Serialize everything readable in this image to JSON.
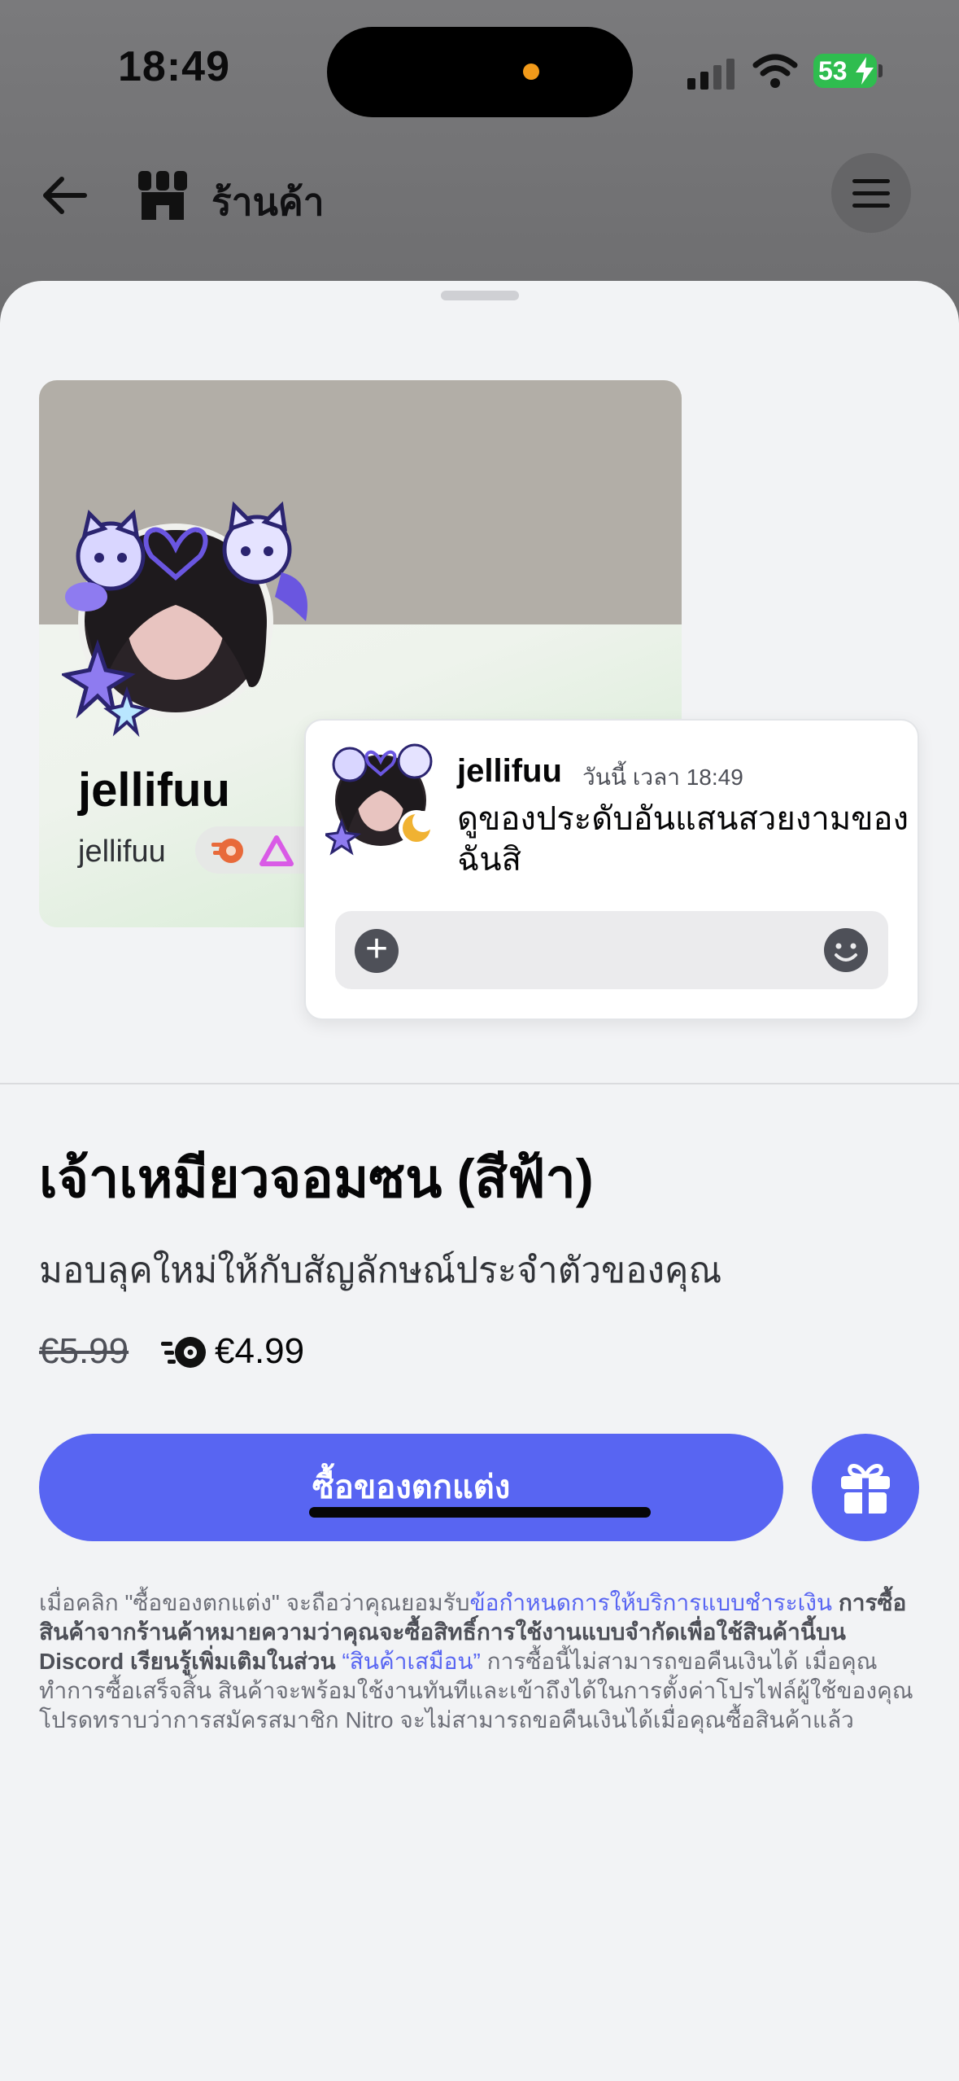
{
  "status_bar": {
    "time": "18:49",
    "battery_percent": "53",
    "signal_icon": "cellular-signal-icon",
    "wifi_icon": "wifi-icon",
    "battery_icon": "battery-charging-icon"
  },
  "header": {
    "title": "ร้านค้า",
    "back_icon": "arrow-left-icon",
    "shop_icon": "shop-icon",
    "menu_icon": "hamburger-menu-icon"
  },
  "preview": {
    "profile": {
      "display_name": "jellifuu",
      "username": "jellifuu",
      "badges": [
        "nitro-boost-badge-icon",
        "purple-triangle-badge-icon"
      ]
    },
    "message": {
      "author": "jellifuu",
      "timestamp": "วันนี้ เวลา 18:49",
      "text": "ดูของประดับอันแสนสวยงามของฉันสิ"
    }
  },
  "product": {
    "title": "เจ้าเหมียวจอมซน (สีฟ้า)",
    "description": "มอบลุคใหม่ให้กับสัญลักษณ์ประจำตัวของคุณ",
    "price_original": "€5.99",
    "price_nitro": "€4.99",
    "buy_label": "ซื้อของตกแต่ง",
    "gift_icon": "gift-icon"
  },
  "legal": {
    "part1": "เมื่อคลิก \"ซื้อของตกแต่ง\" จะถือว่าคุณยอมรับ",
    "link_terms": "ข้อกำหนดการให้บริการแบบชำระเงิน",
    "part2": " การซื้อสินค้าจากร้านค้าหมายความว่าคุณจะซื้อสิทธิ์การใช้งานแบบจำกัดเพื่อใช้สินค้านี้บน Discord เรียนรู้เพิ่มเติมในส่วน ",
    "link_similar": "“สินค้าเสมือน”",
    "part3": " การซื้อนี้ไม่สามารถขอคืนเงินได้ เมื่อคุณทำการซื้อเสร็จสิ้น สินค้าจะพร้อมใช้งานทันทีและเข้าถึงได้ในการตั้งค่าโปรไฟล์ผู้ใช้ของคุณ โปรดทราบว่าการสมัครสมาชิก Nitro จะไม่สามารถขอคืนเงินได้เมื่อคุณซื้อสินค้าแล้ว"
  },
  "colors": {
    "accent": "#5865f2",
    "sheet_bg": "#f2f3f5",
    "banner": "#b2aea7"
  }
}
